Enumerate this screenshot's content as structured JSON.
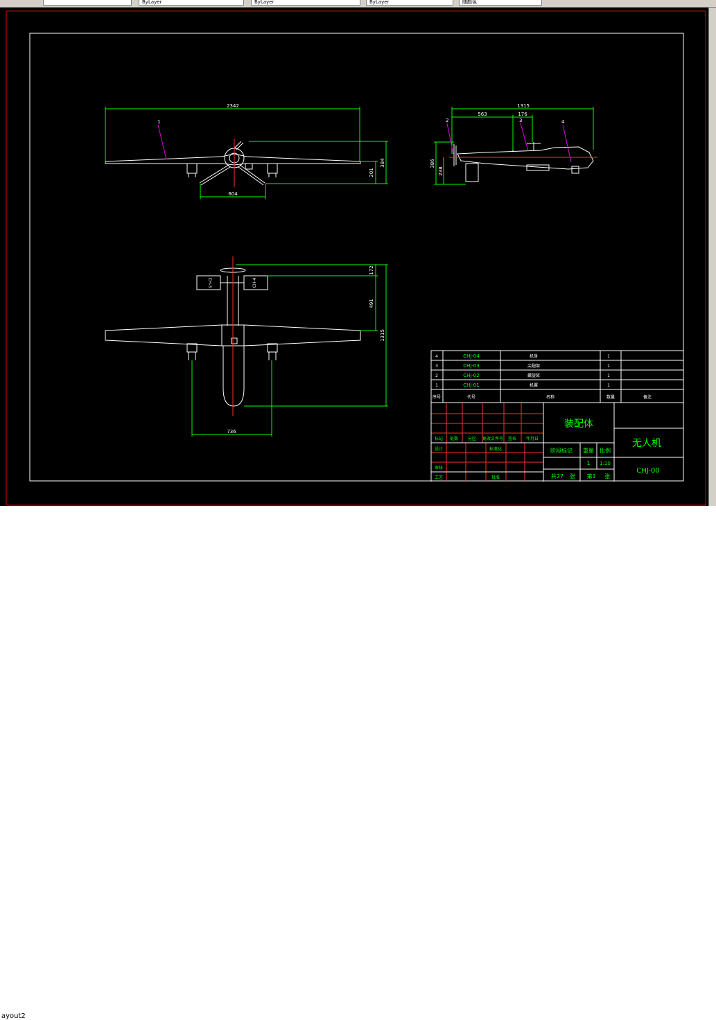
{
  "toolbar": {
    "cells": [
      "",
      "ByLayer",
      "ByLayer",
      "ByLayer",
      "随颜色"
    ]
  },
  "layout_tab": "ayout2",
  "drawing": {
    "front_view": {
      "dim_span": "2342",
      "dim_height_1": "201",
      "dim_height_2": "384",
      "dim_gear": "604",
      "balloon": "1"
    },
    "side_view": {
      "dim_total": "1315",
      "dim_a": "563",
      "dim_b": "176",
      "dim_h1": "386",
      "dim_h2": "238",
      "balloon_2": "2",
      "balloon_3": "3",
      "balloon_4": "4"
    },
    "top_view": {
      "dim_tail": "172",
      "dim_mid": "491",
      "dim_total": "1315",
      "dim_gear": "736",
      "tail_label_left": "CH-3",
      "tail_label_right": "CH-4"
    }
  },
  "bom": {
    "rows": [
      {
        "no": "4",
        "code": "CHJ-04",
        "name": "机身",
        "qty": "1"
      },
      {
        "no": "3",
        "code": "CHJ-03",
        "name": "尖翅架",
        "qty": "1"
      },
      {
        "no": "2",
        "code": "CHJ-02",
        "name": "螺旋桨",
        "qty": "1"
      },
      {
        "no": "1",
        "code": "CHJ-01",
        "name": "机翼",
        "qty": "1"
      }
    ],
    "header": {
      "no": "序号",
      "code": "代号",
      "name": "名称",
      "qty": "数量",
      "remark": "备注"
    }
  },
  "title_block": {
    "assembly": "装配体",
    "product": "无人机",
    "drawing_no": "CHJ-00",
    "marks": "阶段标记",
    "weight": "重量",
    "scale": "比例",
    "qty": "1",
    "scale_value": "1:10",
    "sheets_total": "共27",
    "sheet_unit": "张",
    "sheet_no": "第1",
    "sheet_unit2": "张",
    "row_mark": "标记",
    "row_count": "处数",
    "row_zone": "分区",
    "row_change": "更改文件号",
    "row_sign": "签名",
    "row_date": "年月日",
    "design": "设计",
    "standard": "标准化",
    "check": "审核",
    "process": "工艺",
    "approve": "批准"
  }
}
